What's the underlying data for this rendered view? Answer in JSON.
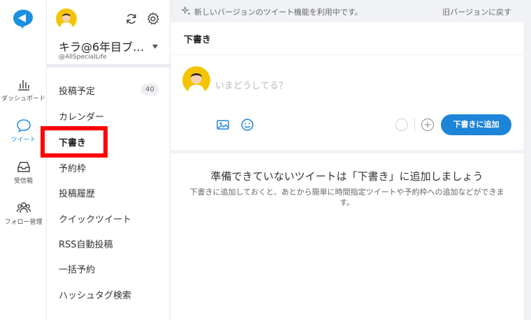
{
  "rail": {
    "items": [
      {
        "label": "ダッシュボード",
        "icon": "bar-chart-icon"
      },
      {
        "label": "ツイート",
        "icon": "speech-bubble-icon"
      },
      {
        "label": "受信箱",
        "icon": "inbox-icon"
      },
      {
        "label": "フォロー管理",
        "icon": "people-icon"
      }
    ]
  },
  "profile": {
    "name": "キラ@6年目ブ…",
    "handle": "@AllSpecialLife"
  },
  "menu": {
    "items": [
      {
        "label": "投稿予定",
        "badge": "40"
      },
      {
        "label": "カレンダー"
      },
      {
        "label": "下書き"
      },
      {
        "label": "予約枠"
      },
      {
        "label": "投稿履歴"
      },
      {
        "label": "クイックツイート"
      },
      {
        "label": "RSS自動投稿"
      },
      {
        "label": "一括予約"
      },
      {
        "label": "ハッシュタグ検索"
      }
    ]
  },
  "notice": {
    "message": "新しいバージョンのツイート機能を利用中です。",
    "back_link": "旧バージョンに戻す"
  },
  "composer": {
    "title": "下書き",
    "placeholder": "いまどうしてる？",
    "add_button": "下書きに追加"
  },
  "empty_state": {
    "title": "準備できていないツイートは「下書き」に追加しましょう",
    "description": "下書きに追加しておくと、あとから簡単に時間指定ツイートや予約枠への追加などができます。"
  },
  "colors": {
    "accent": "#1d84d8",
    "highlight": "#ff0000"
  }
}
